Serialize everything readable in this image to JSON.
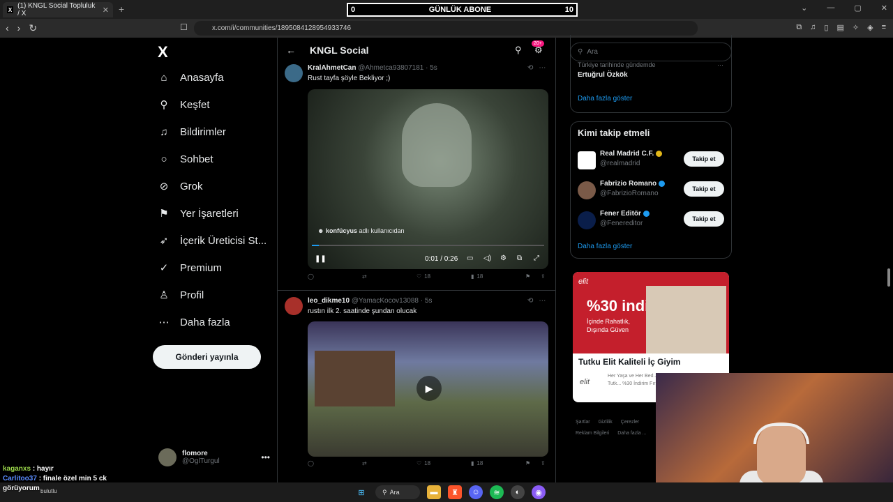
{
  "browser": {
    "tab_title": "(1) KNGL Social Topluluk / X",
    "url": "x.com/i/communities/1895084128954933746"
  },
  "stream_overlay": {
    "left": "0",
    "label": "GÜNLÜK ABONE",
    "right": "10"
  },
  "leftnav": {
    "logo": "X",
    "items": [
      {
        "label": "Anasayfa",
        "icon": "home-icon"
      },
      {
        "label": "Keşfet",
        "icon": "search-icon"
      },
      {
        "label": "Bildirimler",
        "icon": "bell-icon"
      },
      {
        "label": "Sohbet",
        "icon": "chat-icon"
      },
      {
        "label": "Grok",
        "icon": "grok-icon"
      },
      {
        "label": "Yer İşaretleri",
        "icon": "bookmark-icon"
      },
      {
        "label": "İçerik Üreticisi St...",
        "icon": "rocket-icon"
      },
      {
        "label": "Premium",
        "icon": "premium-icon"
      },
      {
        "label": "Profil",
        "icon": "profile-icon"
      },
      {
        "label": "Daha fazla",
        "icon": "more-icon"
      }
    ],
    "post_button": "Gönderi yayınla",
    "user_name": "flomore",
    "user_handle": "@OglTurgul"
  },
  "header": {
    "title": "KNGL Social",
    "badge": "20+"
  },
  "posts": [
    {
      "name": "KralAhmetCan",
      "handle": "@Ahmetca93807181 · 5s",
      "text": "Rust tayfa şöyle Bekliyor ;)",
      "video_credit_user": "konfücyus",
      "video_credit_rest": "adlı kullanıcıdan",
      "time": "0:01 / 0:26",
      "likes": "18",
      "views": "18"
    },
    {
      "name": "leo_dikme10",
      "handle": "@YamacKocov13088 · 5s",
      "text": "rustın ilk 2. saatinde şundan olucak",
      "likes": "18",
      "views": "18"
    }
  ],
  "right": {
    "search_placeholder": "Ara",
    "trend_sub": "Türkiye tarihinde gündemde",
    "trend_title": "Ertuğrul Özkök",
    "show_more": "Daha fazla göster",
    "wtf_title": "Kimi takip etmeli",
    "follow_label": "Takip et",
    "suggestions": [
      {
        "name": "Real Madrid C.F.",
        "handle": "@realmadrid"
      },
      {
        "name": "Fabrizio Romano",
        "handle": "@FabrizioRomano"
      },
      {
        "name": "Fener Editör",
        "handle": "@Fenereditor"
      }
    ],
    "show_more2": "Daha fazla göster",
    "ad": {
      "brand": "elit",
      "pct": "%30 indirim",
      "sub1": "İçinde Rahatlık,",
      "sub2": "Dışında Güven",
      "title": "Tutku Elit Kaliteli İç Giyim",
      "desc": "Her Yaşa ve Her Bed... Giyimin Adresi Tutk... %30 İndirim Fırsatı",
      "logo": "elit"
    },
    "footer": [
      "Şartlar",
      "Gizlilik",
      "Çerezler",
      "Reklam Bilgileri",
      "Daha fazla ..."
    ]
  },
  "chat": [
    {
      "user": "kaganxs",
      "msg": ": hayır"
    },
    {
      "user": "Carlitoo37",
      "msg": ": finale özel min 5 ck"
    },
    {
      "user": "",
      "msg": "görüyorum"
    }
  ],
  "taskbar": {
    "weather": "bulutlu",
    "search": "Ara"
  }
}
